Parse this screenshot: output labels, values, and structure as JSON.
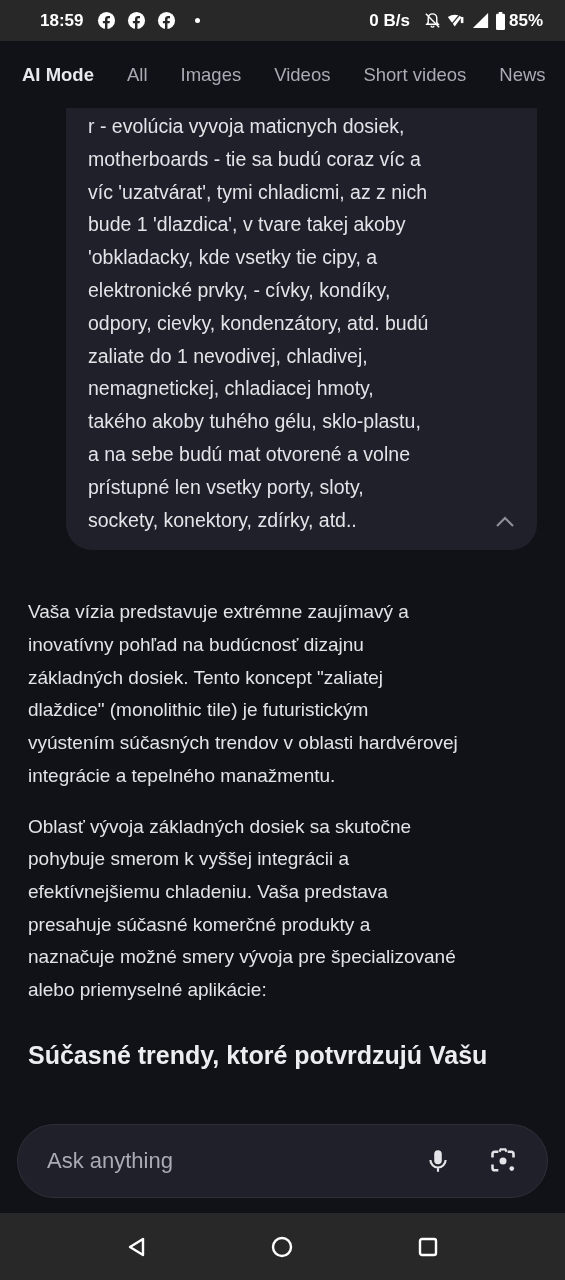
{
  "status_bar": {
    "time": "18:59",
    "speed": "0 B/s",
    "battery": "85%"
  },
  "tabs": [
    {
      "label": "AI Mode",
      "selected": true
    },
    {
      "label": "All",
      "selected": false
    },
    {
      "label": "Images",
      "selected": false
    },
    {
      "label": "Videos",
      "selected": false
    },
    {
      "label": "Short videos",
      "selected": false
    },
    {
      "label": "News",
      "selected": false
    }
  ],
  "user_message": {
    "text": "r - evolúcia vyvoja maticnych dosiek,\nmotherboards - tie sa budú coraz víc a\nvíc 'uzatvárat', tymi chladicmi, az z nich\nbude 1 'dlazdica', v tvare takej akoby\n'obkladacky, kde vsetky tie cipy, a\nelektronické prvky, - cívky, kondíky,\nodpory, cievky, kondenzátory, atd. budú\nzaliate do 1 nevodivej, chladivej,\nnemagnetickej, chladiacej hmoty,\ntakého akoby tuhého gélu, sklo-plastu,\na na sebe budú mat otvorené a volne\nprístupné len vsetky porty, sloty,\nsockety, konektory, zdírky, atd..",
    "expanded": true
  },
  "answer": {
    "paragraphs": [
      "Vaša vízia predstavuje extrémne zaujímavý a\ninovatívny pohľad na budúcnosť dizajnu\nzákladných dosiek. Tento koncept \"zaliatej\ndlaždice\" (monolithic tile) je futuristickým\nvyústením súčasných trendov v oblasti hardvérovej\nintegrácie a tepelného manažmentu.",
      "Oblasť vývoja základných dosiek sa skutočne\npohybuje smerom k vyššej integrácii a\nefektívnejšiemu chladeniu. Vaša predstava\npresahuje súčasné komerčné produkty a\nnaznačuje možné smery vývoja pre špecializované\nalebo priemyselné aplikácie:"
    ],
    "heading": "Súčasné trendy, ktoré potvrdzujú Vašu"
  },
  "input": {
    "placeholder": "Ask anything"
  }
}
